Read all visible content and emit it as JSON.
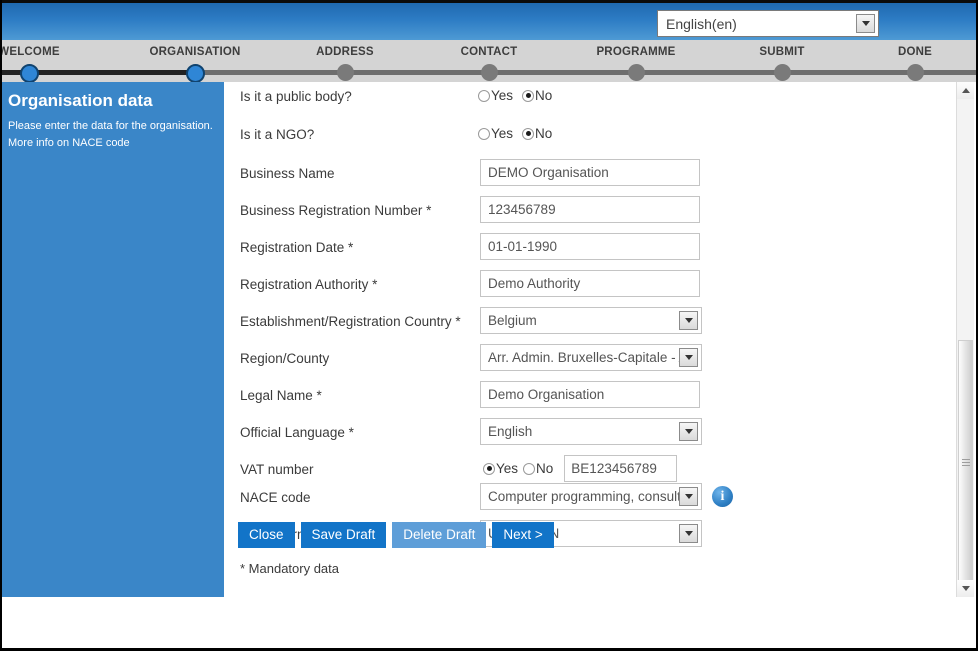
{
  "header": {
    "language_value": "English(en)",
    "dropdown_icon": "chevron-down-icon"
  },
  "wizard": {
    "steps": [
      {
        "label": "WELCOME",
        "state": "done"
      },
      {
        "label": "ORGANISATION",
        "state": "active"
      },
      {
        "label": "ADDRESS",
        "state": "pending"
      },
      {
        "label": "CONTACT",
        "state": "pending"
      },
      {
        "label": "PROGRAMME",
        "state": "pending"
      },
      {
        "label": "SUBMIT",
        "state": "pending"
      },
      {
        "label": "DONE",
        "state": "pending"
      }
    ]
  },
  "sidebar": {
    "title": "Organisation data",
    "description": "Please enter the data for the organisation.",
    "link": "More info on NACE code"
  },
  "form": {
    "public_body": {
      "label": "Is it a public body?",
      "yes_label": "Yes",
      "no_label": "No",
      "selected": "No"
    },
    "ngo": {
      "label": "Is it a NGO?",
      "yes_label": "Yes",
      "no_label": "No",
      "selected": "No"
    },
    "business_name": {
      "label": "Business Name",
      "value": "DEMO Organisation"
    },
    "business_registration_number": {
      "label": "Business Registration Number *",
      "value": "123456789"
    },
    "registration_date": {
      "label": "Registration Date *",
      "value": "01-01-1990"
    },
    "registration_authority": {
      "label": "Registration Authority *",
      "value": "Demo Authority"
    },
    "country": {
      "label": "Establishment/Registration Country *",
      "value": "Belgium"
    },
    "region": {
      "label": "Region/County",
      "value": "Arr. Admin. Bruxelles-Capitale - A"
    },
    "legal_name": {
      "label": "Legal Name *",
      "value": "Demo Organisation"
    },
    "official_language": {
      "label": "Official Language *",
      "value": "English"
    },
    "vat_number": {
      "label": "VAT number",
      "yes_label": "Yes",
      "no_label": "No",
      "selected": "Yes",
      "value": "BE123456789"
    },
    "nace_code": {
      "label": "NACE code",
      "value": "Computer programming, consultancy",
      "info_icon": "info-icon"
    },
    "legal_form": {
      "label": "Legal Form",
      "value": "UNKNOWN"
    },
    "mandatory_note": "* Mandatory data"
  },
  "buttons": {
    "close": "Close",
    "save_draft": "Save Draft",
    "delete_draft": "Delete Draft",
    "next": "Next >"
  },
  "scrollbar": {
    "up_icon": "arrow-up-icon",
    "down_icon": "arrow-down-icon"
  },
  "colors": {
    "header_blue": "#2d7cc4",
    "sidebar_blue": "#3a86c8",
    "button_blue": "#1274c8",
    "button_blue_light": "#5e9ed8",
    "step_active": "#2f86d6",
    "step_pending": "#7a7a7a"
  }
}
